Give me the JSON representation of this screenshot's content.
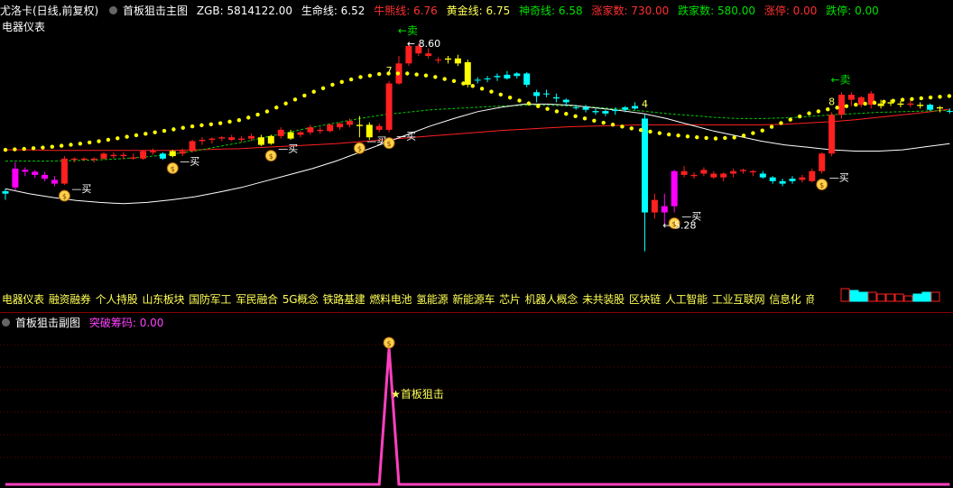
{
  "header": {
    "stock": "尤洛卡(日线,前复权)",
    "main_indicator": "首板狙击主图",
    "zgb": "ZGB: 5814122.00",
    "lifeline": "生命线: 6.52",
    "bullline": "牛熊线: 6.76",
    "goldline": "黄金线: 6.75",
    "magicline": "神奇线: 6.58",
    "up_count": "涨家数: 730.00",
    "down_count": "跌家数: 580.00",
    "limit_up": "涨停: 0.00",
    "limit_down": "跌停: 0.00"
  },
  "sector": "电器仪表",
  "concepts": [
    "电器仪表",
    "融资融券",
    "个人持股",
    "山东板块",
    "国防军工",
    "军民融合",
    "5G概念",
    "铁路基建",
    "燃料电池",
    "氢能源",
    "新能源车",
    "芯片",
    "机器人概念",
    "未共装股",
    "区块链",
    "人工智能",
    "工业互联网",
    "信息化",
    "商业航天"
  ],
  "sub_header": {
    "indicator": "首板狙击副图",
    "breakout": "突破筹码: 0.00"
  },
  "colors": {
    "up": "#ff2020",
    "down": "#00ffff",
    "yellow": "#ffff00",
    "magenta": "#ff00ff",
    "lifeline": "#ffffff",
    "goldline": "#00cc00",
    "bullline": "#ff2020",
    "dots": "#ffff00",
    "spike": "#ff40c0"
  },
  "chart_data": [
    {
      "type": "candlestick",
      "ylim": [
        5.0,
        8.4
      ],
      "candles": [
        [
          6.2,
          6.28,
          6.1,
          6.24,
          "down"
        ],
        [
          6.3,
          6.7,
          6.25,
          6.6,
          "magenta"
        ],
        [
          6.55,
          6.62,
          6.48,
          6.58,
          "magenta"
        ],
        [
          6.55,
          6.58,
          6.45,
          6.5,
          "magenta"
        ],
        [
          6.5,
          6.55,
          6.4,
          6.44,
          "magenta"
        ],
        [
          6.42,
          6.48,
          6.32,
          6.36,
          "magenta"
        ],
        [
          6.36,
          6.8,
          6.34,
          6.76,
          "up"
        ],
        [
          6.74,
          6.78,
          6.7,
          6.76,
          "up"
        ],
        [
          6.76,
          6.78,
          6.72,
          6.74,
          "up"
        ],
        [
          6.74,
          6.78,
          6.7,
          6.76,
          "up"
        ],
        [
          6.76,
          6.86,
          6.74,
          6.84,
          "up"
        ],
        [
          6.82,
          6.86,
          6.76,
          6.8,
          "up"
        ],
        [
          6.8,
          6.86,
          6.75,
          6.82,
          "up"
        ],
        [
          6.78,
          6.84,
          6.74,
          6.76,
          "up"
        ],
        [
          6.76,
          6.9,
          6.74,
          6.88,
          "up"
        ],
        [
          6.88,
          6.92,
          6.82,
          6.86,
          "up"
        ],
        [
          6.76,
          6.86,
          6.74,
          6.84,
          "down"
        ],
        [
          6.8,
          6.9,
          6.78,
          6.88,
          "yellow"
        ],
        [
          6.84,
          6.92,
          6.8,
          6.88,
          "up"
        ],
        [
          6.88,
          7.06,
          6.86,
          7.04,
          "up"
        ],
        [
          7.04,
          7.1,
          6.98,
          7.06,
          "up"
        ],
        [
          7.06,
          7.1,
          7.0,
          7.08,
          "up"
        ],
        [
          7.08,
          7.12,
          7.04,
          7.1,
          "up"
        ],
        [
          7.1,
          7.14,
          7.04,
          7.06,
          "up"
        ],
        [
          7.06,
          7.12,
          7.02,
          7.08,
          "up"
        ],
        [
          7.08,
          7.16,
          7.04,
          7.12,
          "up"
        ],
        [
          6.98,
          7.14,
          6.96,
          7.1,
          "yellow"
        ],
        [
          7.0,
          7.14,
          6.98,
          7.12,
          "yellow"
        ],
        [
          7.12,
          7.26,
          7.08,
          7.22,
          "up"
        ],
        [
          7.08,
          7.22,
          7.06,
          7.18,
          "yellow"
        ],
        [
          7.14,
          7.2,
          7.1,
          7.18,
          "up"
        ],
        [
          7.18,
          7.3,
          7.14,
          7.26,
          "up"
        ],
        [
          7.22,
          7.26,
          7.16,
          7.2,
          "up"
        ],
        [
          7.2,
          7.32,
          7.18,
          7.3,
          "up"
        ],
        [
          7.26,
          7.34,
          7.22,
          7.32,
          "up"
        ],
        [
          7.3,
          7.4,
          7.26,
          7.36,
          "up"
        ],
        [
          7.3,
          7.44,
          7.1,
          7.28,
          "yellow"
        ],
        [
          7.1,
          7.34,
          7.06,
          7.3,
          "yellow"
        ],
        [
          7.28,
          7.32,
          7.18,
          7.22,
          "up"
        ],
        [
          7.22,
          8.0,
          7.18,
          7.96,
          "up"
        ],
        [
          7.96,
          8.4,
          7.94,
          8.28,
          "up"
        ],
        [
          8.28,
          8.6,
          8.24,
          8.56,
          "up"
        ],
        [
          8.56,
          8.6,
          8.4,
          8.44,
          "up"
        ],
        [
          8.44,
          8.52,
          8.36,
          8.4,
          "up"
        ],
        [
          8.34,
          8.38,
          8.28,
          8.34,
          "up"
        ],
        [
          8.34,
          8.4,
          8.28,
          8.36,
          "yellow"
        ],
        [
          8.36,
          8.42,
          8.24,
          8.28,
          "yellow"
        ],
        [
          7.94,
          8.34,
          7.9,
          8.3,
          "yellow"
        ],
        [
          8.02,
          8.06,
          7.96,
          8.02,
          "down"
        ],
        [
          8.04,
          8.08,
          7.98,
          8.04,
          "down"
        ],
        [
          8.06,
          8.12,
          8.0,
          8.08,
          "down"
        ],
        [
          8.1,
          8.16,
          8.02,
          8.04,
          "down"
        ],
        [
          8.08,
          8.14,
          8.04,
          8.12,
          "down"
        ],
        [
          8.12,
          8.14,
          7.9,
          7.94,
          "down"
        ],
        [
          7.76,
          7.86,
          7.66,
          7.82,
          "down"
        ],
        [
          7.8,
          7.86,
          7.74,
          7.8,
          "down"
        ],
        [
          7.74,
          7.8,
          7.66,
          7.72,
          "down"
        ],
        [
          7.66,
          7.72,
          7.6,
          7.7,
          "down"
        ],
        [
          7.58,
          7.62,
          7.54,
          7.58,
          "down"
        ],
        [
          7.58,
          7.62,
          7.5,
          7.54,
          "down"
        ],
        [
          7.52,
          7.56,
          7.46,
          7.5,
          "down"
        ],
        [
          7.48,
          7.54,
          7.44,
          7.52,
          "down"
        ],
        [
          7.52,
          7.58,
          7.46,
          7.54,
          "down"
        ],
        [
          7.54,
          7.6,
          7.5,
          7.58,
          "down"
        ],
        [
          7.6,
          7.66,
          7.54,
          7.56,
          "down"
        ],
        [
          7.4,
          7.46,
          5.28,
          5.9,
          "down"
        ],
        [
          5.9,
          6.2,
          5.8,
          6.1,
          "up"
        ],
        [
          6.0,
          6.2,
          5.7,
          5.9,
          "magenta"
        ],
        [
          6.0,
          6.58,
          5.9,
          6.56,
          "magenta"
        ],
        [
          6.56,
          6.64,
          6.46,
          6.5,
          "up"
        ],
        [
          6.5,
          6.54,
          6.44,
          6.48,
          "up"
        ],
        [
          6.58,
          6.62,
          6.48,
          6.52,
          "up"
        ],
        [
          6.52,
          6.56,
          6.44,
          6.46,
          "up"
        ],
        [
          6.46,
          6.54,
          6.4,
          6.52,
          "up"
        ],
        [
          6.52,
          6.6,
          6.46,
          6.56,
          "up"
        ],
        [
          6.56,
          6.6,
          6.52,
          6.58,
          "up"
        ],
        [
          6.56,
          6.58,
          6.48,
          6.54,
          "up"
        ],
        [
          6.52,
          6.56,
          6.44,
          6.46,
          "down"
        ],
        [
          6.46,
          6.48,
          6.36,
          6.4,
          "down"
        ],
        [
          6.4,
          6.44,
          6.32,
          6.36,
          "down"
        ],
        [
          6.4,
          6.48,
          6.36,
          6.44,
          "down"
        ],
        [
          6.42,
          6.5,
          6.38,
          6.46,
          "up"
        ],
        [
          6.4,
          6.6,
          6.38,
          6.56,
          "up"
        ],
        [
          6.56,
          6.86,
          6.52,
          6.84,
          "up"
        ],
        [
          6.84,
          7.5,
          6.8,
          7.46,
          "up"
        ],
        [
          7.46,
          7.82,
          7.4,
          7.78,
          "up"
        ],
        [
          7.78,
          7.82,
          7.6,
          7.7,
          "up"
        ],
        [
          7.74,
          7.76,
          7.58,
          7.62,
          "up"
        ],
        [
          7.62,
          7.84,
          7.56,
          7.8,
          "up"
        ],
        [
          7.6,
          7.7,
          7.56,
          7.64,
          "yellow"
        ],
        [
          7.64,
          7.7,
          7.6,
          7.66,
          "yellow"
        ],
        [
          7.62,
          7.68,
          7.58,
          7.64,
          "yellow"
        ],
        [
          7.64,
          7.7,
          7.58,
          7.62,
          "up"
        ],
        [
          7.6,
          7.66,
          7.56,
          7.62,
          "yellow"
        ],
        [
          7.62,
          7.64,
          7.52,
          7.54,
          "down"
        ],
        [
          7.56,
          7.6,
          7.5,
          7.58,
          "yellow"
        ],
        [
          7.52,
          7.56,
          7.48,
          7.52,
          "down"
        ]
      ],
      "lifeline": [
        6.28,
        6.2,
        6.14,
        6.09,
        6.06,
        6.04,
        6.06,
        6.1,
        6.15,
        6.22,
        6.3,
        6.4,
        6.5,
        6.6,
        6.72,
        6.86,
        7.0,
        7.14,
        7.28,
        7.4,
        7.51,
        7.58,
        7.63,
        7.63,
        7.61,
        7.57,
        7.53,
        7.48,
        7.4,
        7.3,
        7.2,
        7.12,
        7.04,
        6.98,
        6.94,
        6.9,
        6.88,
        6.88,
        6.9,
        6.95,
        7.0
      ],
      "goldline": [
        6.72,
        6.72,
        6.72,
        6.73,
        6.74,
        6.76,
        6.79,
        6.83,
        6.88,
        6.95,
        7.02,
        7.1,
        7.18,
        7.26,
        7.33,
        7.4,
        7.46,
        7.5,
        7.54,
        7.56,
        7.58,
        7.6,
        7.61,
        7.61,
        7.6,
        7.58,
        7.55,
        7.52,
        7.48,
        7.45,
        7.42,
        7.4,
        7.4,
        7.41,
        7.43,
        7.46,
        7.48,
        7.5,
        7.51,
        7.52,
        7.53
      ],
      "bullline": [
        6.9,
        6.9,
        6.89,
        6.89,
        6.89,
        6.89,
        6.89,
        6.89,
        6.9,
        6.91,
        6.92,
        6.94,
        6.96,
        6.98,
        7.0,
        7.03,
        7.06,
        7.09,
        7.12,
        7.15,
        7.18,
        7.21,
        7.23,
        7.25,
        7.27,
        7.28,
        7.29,
        7.3,
        7.3,
        7.3,
        7.3,
        7.3,
        7.3,
        7.31,
        7.33,
        7.35,
        7.38,
        7.42,
        7.46,
        7.5,
        7.55
      ],
      "dotline": [
        6.9,
        6.92,
        6.95,
        6.99,
        7.04,
        7.1,
        7.16,
        7.22,
        7.28,
        7.32,
        7.38,
        7.5,
        7.66,
        7.82,
        7.96,
        8.06,
        8.12,
        8.12,
        8.08,
        8.0,
        7.9,
        7.78,
        7.66,
        7.55,
        7.45,
        7.36,
        7.28,
        7.21,
        7.15,
        7.11,
        7.08,
        7.1,
        7.2,
        7.35,
        7.48,
        7.56,
        7.62,
        7.66,
        7.7,
        7.73,
        7.76
      ],
      "annotations": [
        {
          "index": 39,
          "text": "7",
          "pos": "above"
        },
        {
          "index": 41,
          "text": "8.60",
          "pos": "label-high",
          "arrow": "←"
        },
        {
          "index": 41,
          "text": "卖",
          "pos": "sell"
        },
        {
          "index": 65,
          "text": "4",
          "pos": "above"
        },
        {
          "index": 67,
          "text": "5.28",
          "pos": "label-low",
          "arrow": "←"
        },
        {
          "index": 84,
          "text": "8",
          "pos": "above"
        },
        {
          "index": 85,
          "text": "卖",
          "pos": "sell"
        }
      ],
      "buy_signals": [
        6,
        17,
        27,
        36,
        39,
        68,
        83
      ],
      "buy_label": "买"
    },
    {
      "type": "line",
      "series": [
        {
          "values": [
            0,
            0,
            0,
            0,
            0,
            0,
            0,
            0,
            0,
            0,
            0,
            0,
            0,
            0,
            0,
            0,
            0,
            0,
            0,
            0,
            0,
            0,
            0,
            0,
            0,
            0,
            0,
            0,
            0,
            0,
            0,
            0,
            0,
            0,
            0,
            0,
            0,
            0,
            0,
            1,
            0,
            0,
            0,
            0,
            0,
            0,
            0,
            0,
            0,
            0,
            0,
            0,
            0,
            0,
            0,
            0,
            0,
            0,
            0,
            0,
            0,
            0,
            0,
            0,
            0,
            0,
            0,
            0,
            0,
            0,
            0,
            0,
            0,
            0,
            0,
            0,
            0,
            0,
            0,
            0,
            0,
            0,
            0,
            0,
            0,
            0,
            0,
            0,
            0,
            0,
            0,
            0,
            0,
            0,
            0,
            0,
            0
          ]
        }
      ],
      "annotation": "★首板狙击"
    }
  ]
}
